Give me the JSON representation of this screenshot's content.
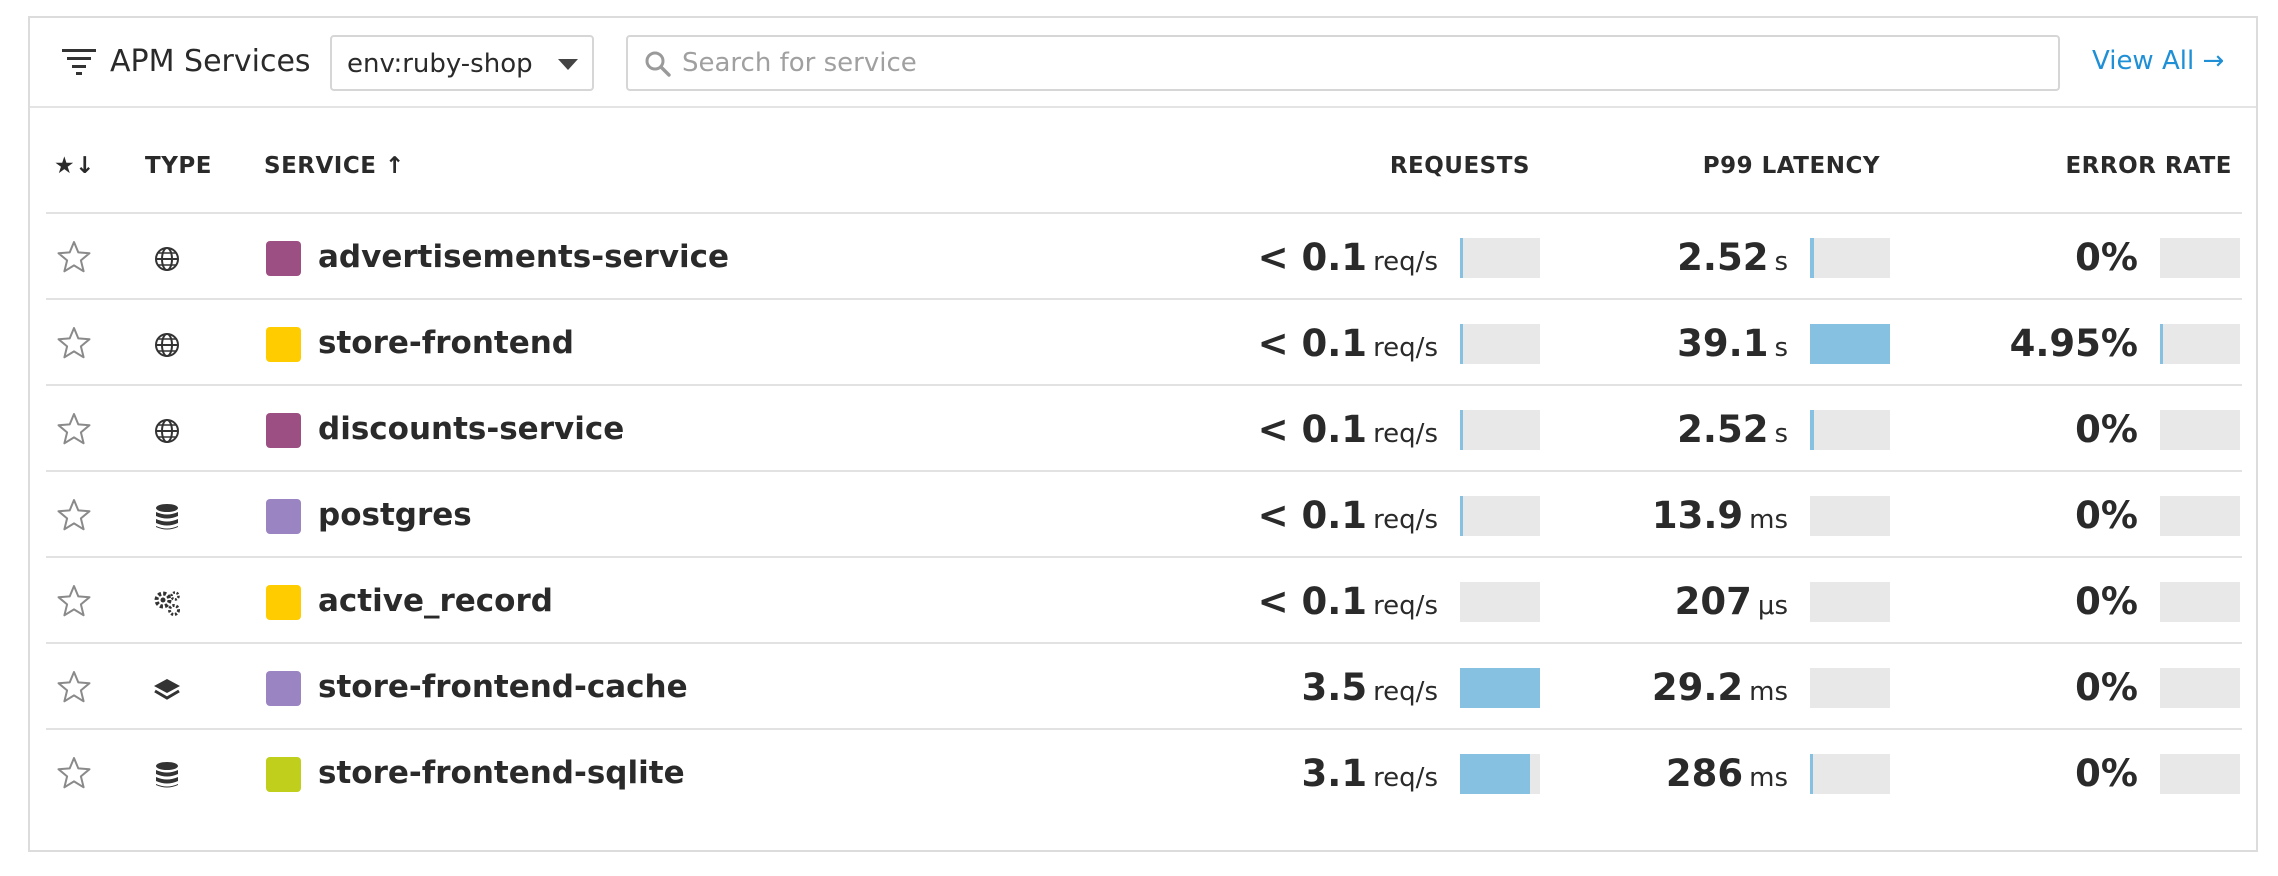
{
  "header": {
    "title": "APM Services",
    "env_value": "env:ruby-shop",
    "search_placeholder": "Search for service",
    "view_all_label": "View All →"
  },
  "columns": {
    "fav": "★↓",
    "type": "TYPE",
    "service": "SERVICE ↑",
    "requests": "REQUESTS",
    "latency": "P99 LATENCY",
    "error_rate": "ERROR RATE"
  },
  "icons": {
    "filter": "filter-lines-icon",
    "search": "magnifier-icon",
    "star": "star-outline-icon",
    "web": "globe-icon",
    "db": "database-icon",
    "custom": "gears-icon",
    "cache": "layers-icon"
  },
  "colors": {
    "accent": "#1f8fd6",
    "bar_fill": "#87c1e2",
    "bar_track": "#e8e8e8"
  },
  "services": [
    {
      "name": "advertisements-service",
      "type": "web",
      "color": "#9c4f82",
      "requests": {
        "value": "< 0.1",
        "unit": "req/s",
        "fill": 0.02
      },
      "latency": {
        "value": "2.52",
        "unit": "s",
        "fill": 0.05
      },
      "error_rate": {
        "value": "0%",
        "fill": 0
      }
    },
    {
      "name": "store-frontend",
      "type": "web",
      "color": "#ffcc00",
      "requests": {
        "value": "< 0.1",
        "unit": "req/s",
        "fill": 0.02
      },
      "latency": {
        "value": "39.1",
        "unit": "s",
        "fill": 1.0
      },
      "error_rate": {
        "value": "4.95%",
        "fill": 0.04
      }
    },
    {
      "name": "discounts-service",
      "type": "web",
      "color": "#9c4f82",
      "requests": {
        "value": "< 0.1",
        "unit": "req/s",
        "fill": 0.02
      },
      "latency": {
        "value": "2.52",
        "unit": "s",
        "fill": 0.05
      },
      "error_rate": {
        "value": "0%",
        "fill": 0
      }
    },
    {
      "name": "postgres",
      "type": "db",
      "color": "#9a84c2",
      "requests": {
        "value": "< 0.1",
        "unit": "req/s",
        "fill": 0.02
      },
      "latency": {
        "value": "13.9",
        "unit": "ms",
        "fill": 0
      },
      "error_rate": {
        "value": "0%",
        "fill": 0
      }
    },
    {
      "name": "active_record",
      "type": "custom",
      "color": "#ffcc00",
      "requests": {
        "value": "< 0.1",
        "unit": "req/s",
        "fill": 0
      },
      "latency": {
        "value": "207",
        "unit": "μs",
        "fill": 0
      },
      "error_rate": {
        "value": "0%",
        "fill": 0
      }
    },
    {
      "name": "store-frontend-cache",
      "type": "cache",
      "color": "#9a84c2",
      "requests": {
        "value": "3.5",
        "unit": "req/s",
        "fill": 1.0
      },
      "latency": {
        "value": "29.2",
        "unit": "ms",
        "fill": 0
      },
      "error_rate": {
        "value": "0%",
        "fill": 0
      }
    },
    {
      "name": "store-frontend-sqlite",
      "type": "db",
      "color": "#bfcf1c",
      "requests": {
        "value": "3.1",
        "unit": "req/s",
        "fill": 0.88
      },
      "latency": {
        "value": "286",
        "unit": "ms",
        "fill": 0.01
      },
      "error_rate": {
        "value": "0%",
        "fill": 0
      }
    }
  ]
}
